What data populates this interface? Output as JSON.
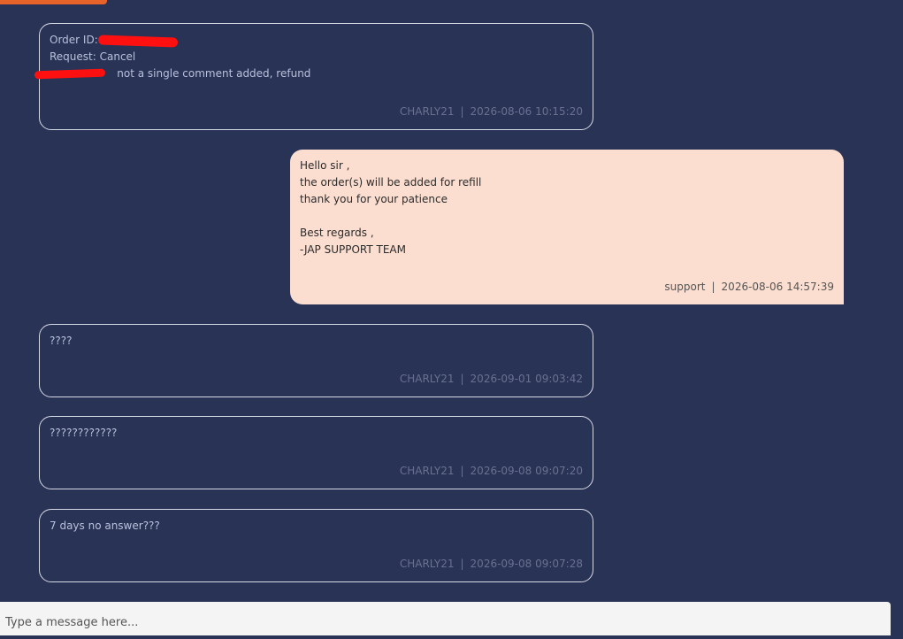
{
  "messages": [
    {
      "author": "CHARLY21",
      "timestamp": "2026-08-06 10:15:20",
      "lines": [
        "Order ID: ",
        "Request: Cancel",
        "                    not a single comment added, refund"
      ]
    },
    {
      "author": "support",
      "timestamp": "2026-08-06 14:57:39",
      "lines": [
        "Hello sir ,",
        "the order(s) will be added for refill",
        "thank you for your patience",
        "",
        "Best regards ,",
        "-JAP SUPPORT TEAM"
      ]
    },
    {
      "author": "CHARLY21",
      "timestamp": "2026-09-01 09:03:42",
      "lines": [
        "????"
      ]
    },
    {
      "author": "CHARLY21",
      "timestamp": "2026-09-08 09:07:20",
      "lines": [
        "????????????"
      ]
    },
    {
      "author": "CHARLY21",
      "timestamp": "2026-09-08 09:07:28",
      "lines": [
        "7 days no answer???"
      ]
    }
  ],
  "meta_separator": "|",
  "composer": {
    "placeholder": "Type a message here..."
  },
  "colors": {
    "background": "#293355",
    "staff_bubble": "#fbded0",
    "accent": "#e8632a",
    "redaction": "#ff1010"
  }
}
